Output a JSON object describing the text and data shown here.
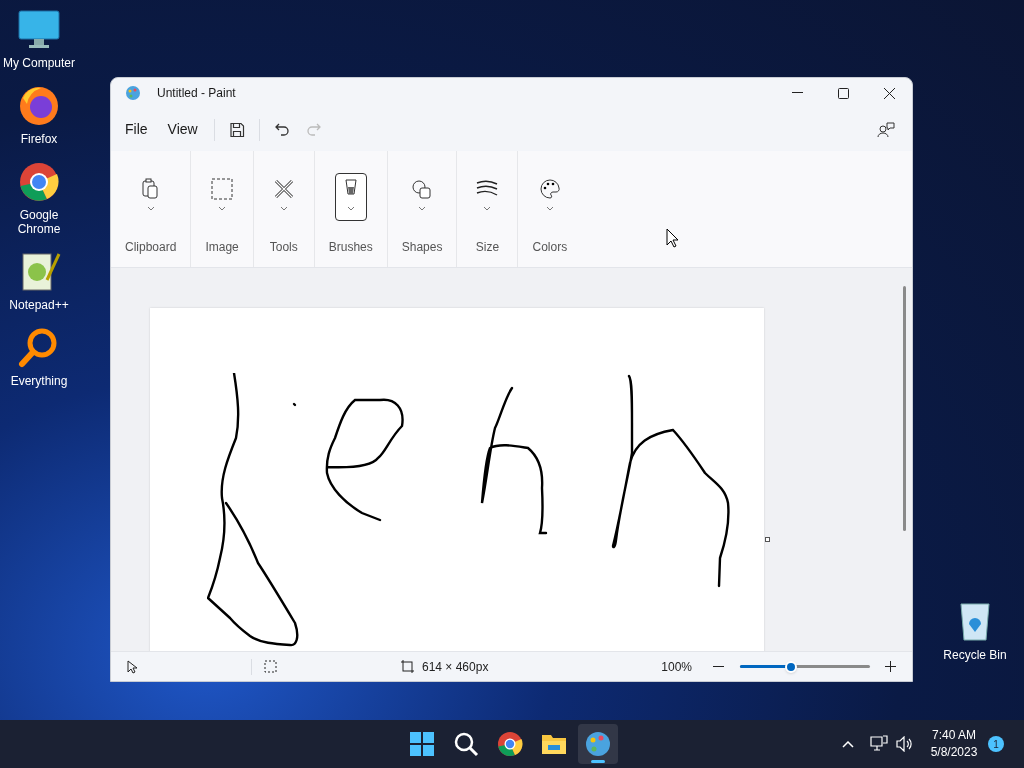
{
  "desktop_icons": [
    {
      "label": "My Computer",
      "kind": "computer"
    },
    {
      "label": "Firefox",
      "kind": "firefox"
    },
    {
      "label": "Google Chrome",
      "kind": "chrome"
    },
    {
      "label": "Notepad++",
      "kind": "notepad"
    },
    {
      "label": "Everything",
      "kind": "search"
    }
  ],
  "recycle_bin": {
    "label": "Recycle Bin"
  },
  "window": {
    "title": "Untitled - Paint",
    "menu": [
      "File",
      "View"
    ],
    "ribbon": [
      {
        "label": "Clipboard",
        "kind": "clipboard",
        "selected": false
      },
      {
        "label": "Image",
        "kind": "image",
        "selected": false
      },
      {
        "label": "Tools",
        "kind": "tools",
        "selected": false
      },
      {
        "label": "Brushes",
        "kind": "brushes",
        "selected": true
      },
      {
        "label": "Shapes",
        "kind": "shapes",
        "selected": false
      },
      {
        "label": "Size",
        "kind": "size",
        "selected": false
      },
      {
        "label": "Colors",
        "kind": "colors",
        "selected": false
      }
    ],
    "status_bar": {
      "canvas_size": "614 × 460px",
      "zoom": "100%",
      "level": 0.39
    }
  },
  "taskbar": {
    "apps": [
      {
        "kind": "start",
        "selected": false
      },
      {
        "kind": "search",
        "selected": false
      },
      {
        "kind": "chrome",
        "selected": false
      },
      {
        "kind": "explorer",
        "selected": false
      },
      {
        "kind": "paint",
        "selected": true
      }
    ],
    "time": "7:40 AM",
    "date": "5/8/2023",
    "notifications": "1"
  }
}
